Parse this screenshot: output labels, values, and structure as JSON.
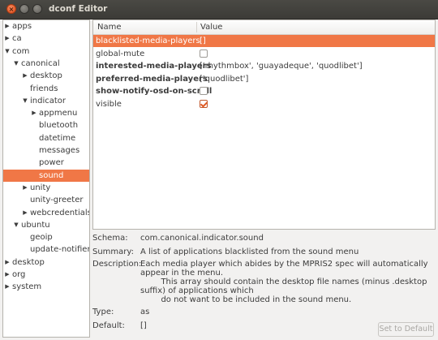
{
  "window": {
    "title": "dconf Editor"
  },
  "tree": [
    {
      "label": "apps",
      "expander": "collapsed",
      "depth": 0
    },
    {
      "label": "ca",
      "expander": "collapsed",
      "depth": 0
    },
    {
      "label": "com",
      "expander": "expanded",
      "depth": 0
    },
    {
      "label": "canonical",
      "expander": "expanded",
      "depth": 1
    },
    {
      "label": "desktop",
      "expander": "collapsed",
      "depth": 2
    },
    {
      "label": "friends",
      "expander": "none",
      "depth": 2
    },
    {
      "label": "indicator",
      "expander": "expanded",
      "depth": 2
    },
    {
      "label": "appmenu",
      "expander": "collapsed",
      "depth": 3
    },
    {
      "label": "bluetooth",
      "expander": "none",
      "depth": 3
    },
    {
      "label": "datetime",
      "expander": "none",
      "depth": 3
    },
    {
      "label": "messages",
      "expander": "none",
      "depth": 3
    },
    {
      "label": "power",
      "expander": "none",
      "depth": 3
    },
    {
      "label": "sound",
      "expander": "none",
      "depth": 3,
      "selected": true
    },
    {
      "label": "unity",
      "expander": "collapsed",
      "depth": 2
    },
    {
      "label": "unity-greeter",
      "expander": "none",
      "depth": 2
    },
    {
      "label": "webcredentials",
      "expander": "collapsed",
      "depth": 2
    },
    {
      "label": "ubuntu",
      "expander": "expanded",
      "depth": 1
    },
    {
      "label": "geoip",
      "expander": "none",
      "depth": 2
    },
    {
      "label": "update-notifier",
      "expander": "none",
      "depth": 2
    },
    {
      "label": "desktop",
      "expander": "collapsed",
      "depth": 0
    },
    {
      "label": "org",
      "expander": "collapsed",
      "depth": 0
    },
    {
      "label": "system",
      "expander": "collapsed",
      "depth": 0
    }
  ],
  "keys_table": {
    "columns": [
      "Name",
      "Value"
    ],
    "rows": [
      {
        "name": "blacklisted-media-players",
        "value": "[]",
        "bold": false,
        "selected": true
      },
      {
        "name": "global-mute",
        "checkbox": false,
        "bold": false
      },
      {
        "name": "interested-media-players",
        "value": "['rhythmbox', 'guayadeque', 'quodlibet']",
        "bold": true
      },
      {
        "name": "preferred-media-players",
        "value": "['quodlibet']",
        "bold": true
      },
      {
        "name": "show-notify-osd-on-scroll",
        "checkbox": false,
        "bold": true
      },
      {
        "name": "visible",
        "checkbox": true,
        "bold": false
      }
    ]
  },
  "info": {
    "schema_label": "Schema:",
    "schema": "com.canonical.indicator.sound",
    "summary_label": "Summary:",
    "summary": "A list of applications blacklisted from the sound menu",
    "description_label": "Description:",
    "description": "Each media player which abides by the MPRIS2 spec will automatically appear in the menu.\n        This array should contain the desktop file names (minus .desktop suffix) of applications which\n        do not want to be included in the sound menu.",
    "type_label": "Type:",
    "type": "as",
    "default_label": "Default:",
    "default": "[]"
  },
  "buttons": {
    "reset": "Set to Default"
  },
  "colors": {
    "selection": "#f07746",
    "titlebar": "#3c3b37",
    "close": "#df4a16"
  },
  "icons": {
    "close": "close-icon",
    "minimize": "minimize-icon",
    "maximize": "maximize-icon",
    "expanded": "triangle-down-icon",
    "collapsed": "triangle-right-icon"
  }
}
